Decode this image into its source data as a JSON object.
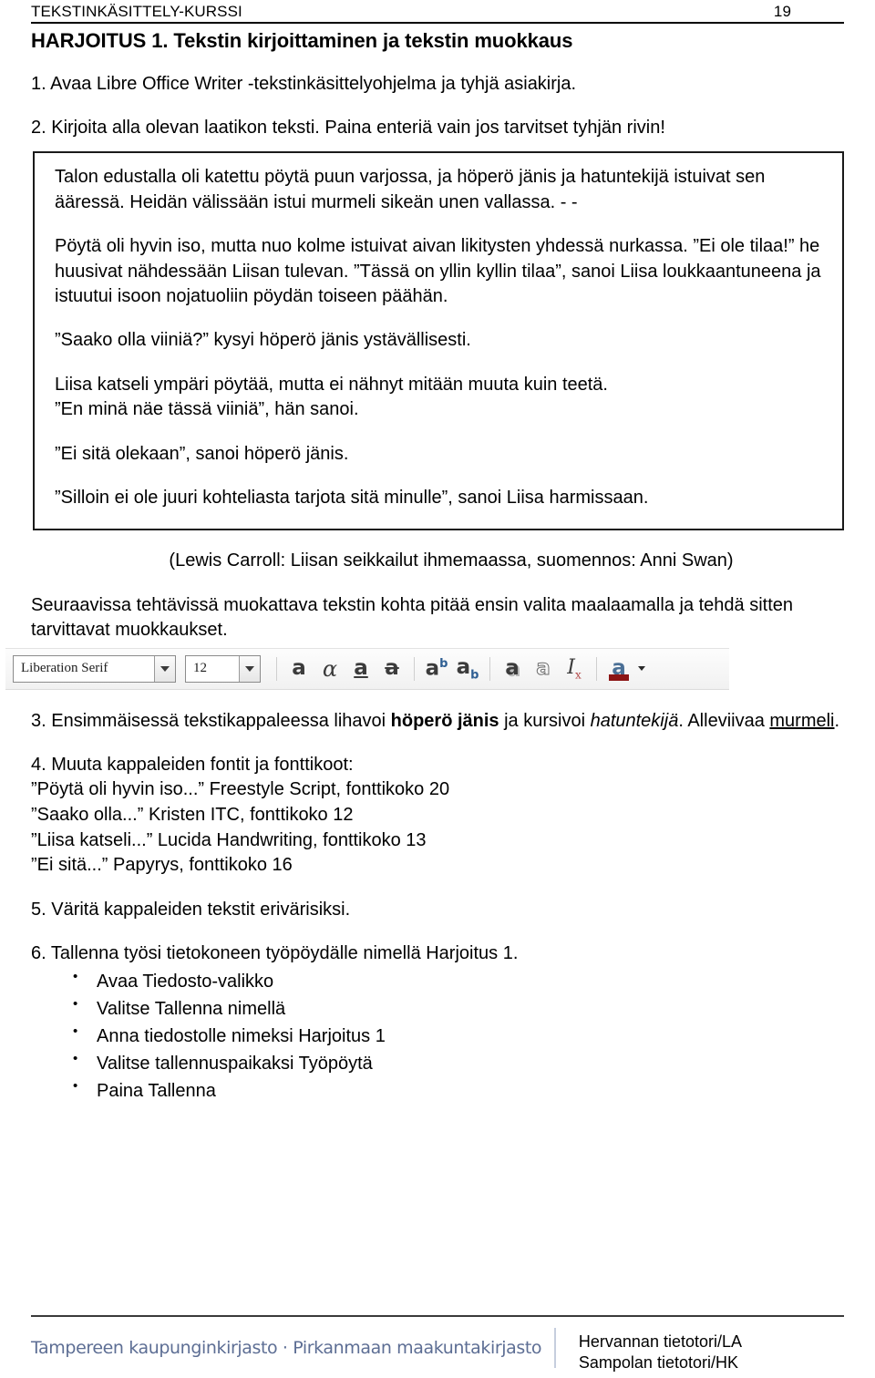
{
  "header": {
    "course_title": "TEKSTINKÄSITTELY-KURSSI",
    "page_number": "19"
  },
  "document": {
    "title": "HARJOITUS 1. Tekstin kirjoittaminen ja tekstin muokkaus",
    "step1": "1. Avaa Libre Office Writer -tekstinkäsittelyohjelma ja tyhjä asiakirja.",
    "step2": "2. Kirjoita alla olevan laatikon teksti. Paina enteriä vain jos tarvitset tyhjän rivin!",
    "step3_prefix": "3. Ensimmäisessä tekstikappaleessa lihavoi ",
    "step3_bold": "höperö jänis",
    "step3_middle": " ja kursivoi ",
    "step3_italic": "hatuntekijä",
    "step3_suffix": ". Alleviivaa ",
    "step3_underline": "murmeli",
    "step3_end": ".",
    "step4_heading": "4. Muuta kappaleiden fontit ja fonttikoot:",
    "step4_lines": [
      "”Pöytä oli hyvin iso...” Freestyle Script, fonttikoko 20",
      "”Saako olla...” Kristen ITC, fonttikoko 12",
      "”Liisa katseli...” Lucida Handwriting, fonttikoko 13",
      "”Ei sitä...” Papyrys, fonttikoko 16"
    ],
    "step5": "5. Väritä kappaleiden tekstit erivärisiksi.",
    "step6": "6. Tallenna työsi tietokoneen työpöydälle nimellä Harjoitus 1.",
    "step6_bullets": [
      "Avaa Tiedosto-valikko",
      "Valitse Tallenna nimellä",
      "Anna tiedostolle nimeksi Harjoitus 1",
      "Valitse tallennuspaikaksi Työpöytä",
      "Paina Tallenna"
    ],
    "lead_in": "Seuraavissa tehtävissä muokattava tekstin kohta pitää ensin valita maalaamalla ja tehdä sitten tarvittavat muokkaukset."
  },
  "quote_box": {
    "paragraphs": [
      "Talon edustalla oli katettu pöytä puun varjossa, ja höperö jänis ja hatuntekijä istuivat sen ääressä. Heidän välissään istui murmeli sikeän unen vallassa. - -",
      "Pöytä oli hyvin iso, mutta nuo kolme istuivat aivan likitysten yhdessä nurkassa. ”Ei ole tilaa!” he huusivat nähdessään Liisan tulevan. ”Tässä on yllin kyllin tilaa”, sanoi Liisa loukkaantuneena ja istuutui isoon nojatuoliin pöydän toiseen päähän.",
      "”Saako olla viiniä?” kysyi höperö jänis ystävällisesti.",
      "Liisa katseli ympäri pöytää, mutta ei nähnyt mitään muuta kuin teetä.\n”En minä näe tässä viiniä”, hän sanoi.",
      "”Ei sitä olekaan”, sanoi höperö jänis.",
      "”Silloin ei ole juuri kohteliasta tarjota sitä minulle”, sanoi Liisa harmissaan."
    ],
    "attribution": "(Lewis Carroll: Liisan seikkailut ihmemaassa, suomennos: Anni Swan)"
  },
  "toolbar": {
    "font_name": "Liberation Serif",
    "font_size": "12",
    "buttons": [
      {
        "name": "bold-icon",
        "glyph": "a"
      },
      {
        "name": "italic-icon",
        "glyph": "α"
      },
      {
        "name": "underline-icon",
        "glyph": "a"
      },
      {
        "name": "strikethrough-icon",
        "glyph": "a"
      },
      {
        "name": "superscript-icon",
        "glyph": "a"
      },
      {
        "name": "subscript-icon",
        "glyph": "a"
      },
      {
        "name": "shadow-icon",
        "glyph": "a"
      },
      {
        "name": "outline-icon",
        "glyph": "a"
      },
      {
        "name": "clear-formatting-icon",
        "glyph": "I"
      },
      {
        "name": "font-color-icon",
        "glyph": "a"
      }
    ],
    "sup_mark": "b",
    "sub_mark": "b",
    "clear_mark": "x",
    "font_color_hex": "#8c1515"
  },
  "footer": {
    "brand": "Tampereen kaupunginkirjasto · Pirkanmaan maakuntakirjasto",
    "right_line1": "Hervannan tietotori/LA",
    "right_line2": "Sampolan tietotori/HK",
    "brand_color_hex": "#5d6e94"
  }
}
